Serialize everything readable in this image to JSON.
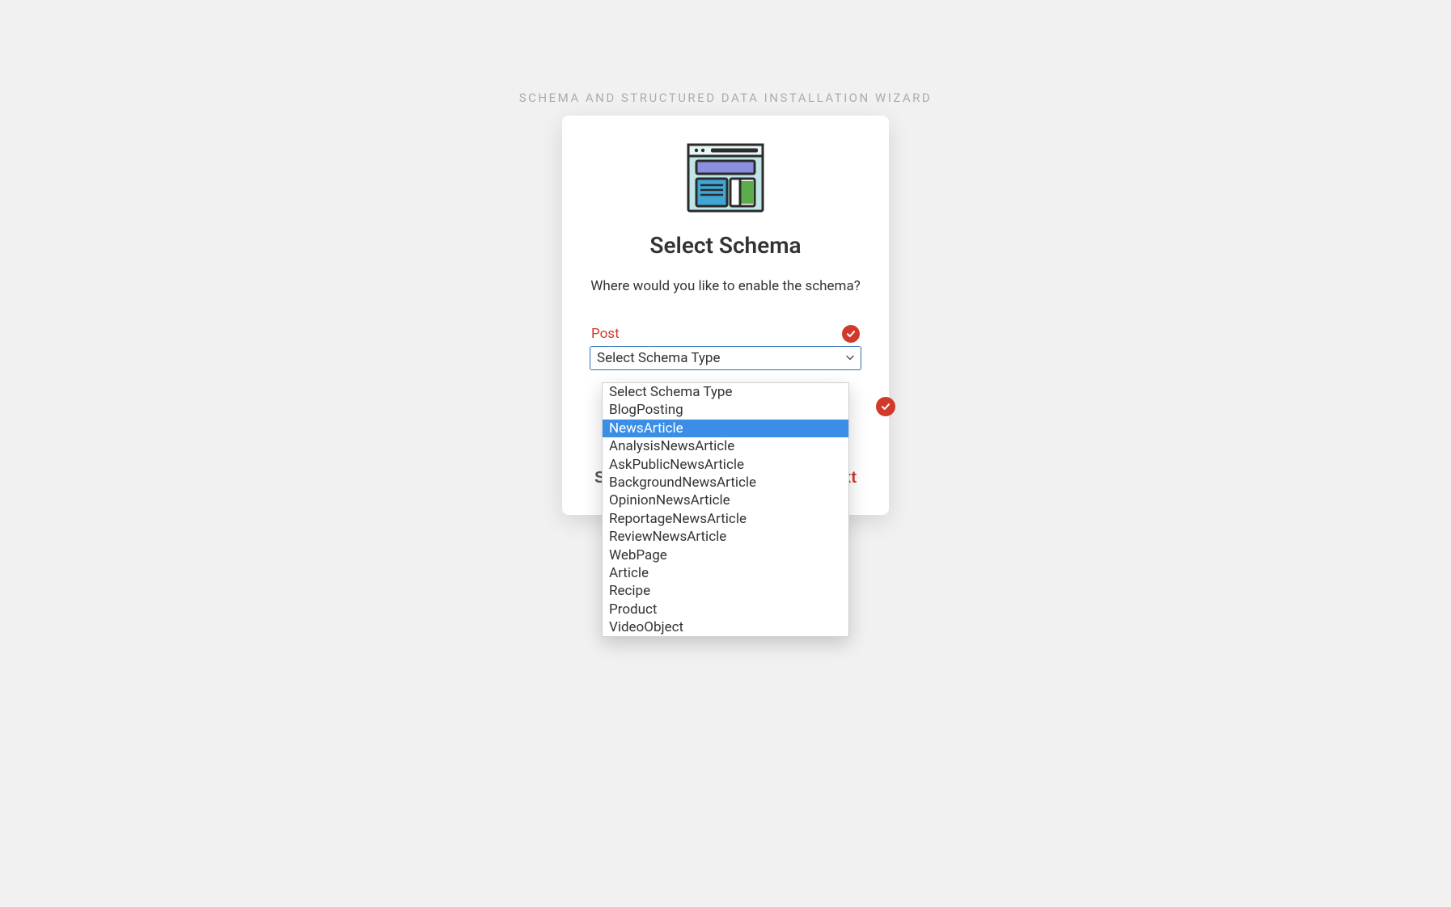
{
  "eyebrow": "SCHEMA AND STRUCTURED DATA INSTALLATION WIZARD",
  "card": {
    "title": "Select Schema",
    "subtitle": "Where would you like to enable the schema?"
  },
  "field": {
    "label": "Post",
    "select_value": "Select Schema Type"
  },
  "footer": {
    "skip": "Skip",
    "next": "Next"
  },
  "dropdown": {
    "highlight_index": 2,
    "options": [
      "Select Schema Type",
      "BlogPosting",
      "NewsArticle",
      "AnalysisNewsArticle",
      "AskPublicNewsArticle",
      "BackgroundNewsArticle",
      "OpinionNewsArticle",
      "ReportageNewsArticle",
      "ReviewNewsArticle",
      "WebPage",
      "Article",
      "Recipe",
      "Product",
      "VideoObject"
    ]
  },
  "colors": {
    "accent_red": "#d13a2a",
    "highlight_blue": "#3a8ee6",
    "card_bg": "#ffffff",
    "page_bg": "#f1f1f1"
  }
}
